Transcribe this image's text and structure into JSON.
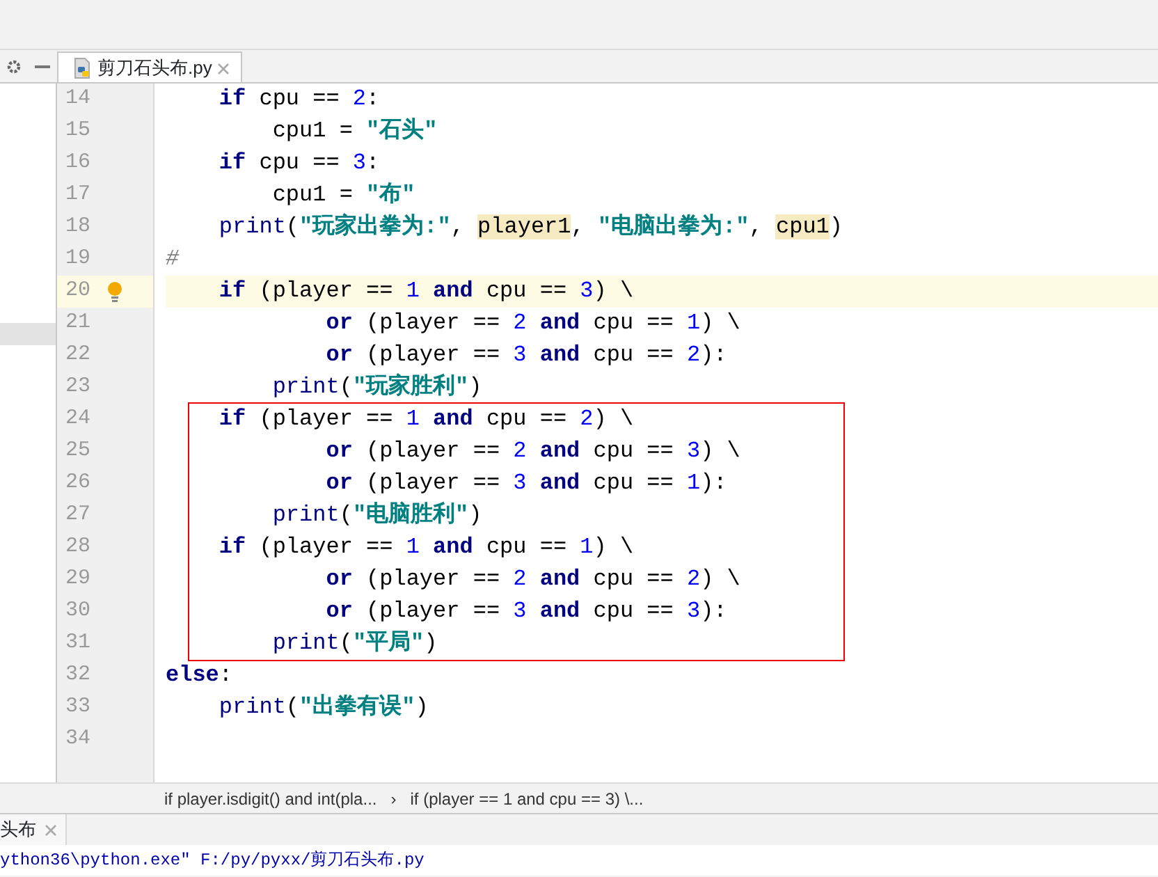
{
  "editor_tab": {
    "label": "剪刀石头布.py",
    "selected": true
  },
  "code_lines": [
    {
      "number": "14",
      "current": false,
      "tokens": [
        {
          "kind": "kw",
          "text": "    if"
        },
        {
          "kind": "plain",
          "text": " cpu == "
        },
        {
          "kind": "num",
          "text": "2"
        },
        {
          "kind": "plain",
          "text": ":"
        }
      ]
    },
    {
      "number": "15",
      "current": false,
      "tokens": [
        {
          "kind": "plain",
          "text": "        cpu1 = "
        },
        {
          "kind": "str",
          "text": "\"石头\""
        }
      ]
    },
    {
      "number": "16",
      "current": false,
      "tokens": [
        {
          "kind": "kw",
          "text": "    if"
        },
        {
          "kind": "plain",
          "text": " cpu == "
        },
        {
          "kind": "num",
          "text": "3"
        },
        {
          "kind": "plain",
          "text": ":"
        }
      ]
    },
    {
      "number": "17",
      "current": false,
      "tokens": [
        {
          "kind": "plain",
          "text": "        cpu1 = "
        },
        {
          "kind": "str",
          "text": "\"布\""
        }
      ]
    },
    {
      "number": "18",
      "current": false,
      "tokens": [
        {
          "kind": "builtin",
          "text": "    print"
        },
        {
          "kind": "plain",
          "text": "("
        },
        {
          "kind": "str",
          "text": "\"玩家出拳为:\""
        },
        {
          "kind": "plain",
          "text": ", "
        },
        {
          "kind": "ref",
          "text": "player1"
        },
        {
          "kind": "plain",
          "text": ", "
        },
        {
          "kind": "str",
          "text": "\"电脑出拳为:\""
        },
        {
          "kind": "plain",
          "text": ", "
        },
        {
          "kind": "ref",
          "text": "cpu1"
        },
        {
          "kind": "plain",
          "text": ")"
        }
      ]
    },
    {
      "number": "19",
      "current": false,
      "tokens": [
        {
          "kind": "comment",
          "text": "#"
        }
      ]
    },
    {
      "number": "20",
      "current": true,
      "tokens": [
        {
          "kind": "kw",
          "text": "    if"
        },
        {
          "kind": "plain",
          "text": " (player == "
        },
        {
          "kind": "num",
          "text": "1"
        },
        {
          "kind": "kw",
          "text": " and"
        },
        {
          "kind": "plain",
          "text": " cpu == "
        },
        {
          "kind": "num",
          "text": "3"
        },
        {
          "kind": "plain",
          "text": ") \\"
        }
      ]
    },
    {
      "number": "21",
      "current": false,
      "tokens": [
        {
          "kind": "kw",
          "text": "            or"
        },
        {
          "kind": "plain",
          "text": " (player == "
        },
        {
          "kind": "num",
          "text": "2"
        },
        {
          "kind": "kw",
          "text": " and"
        },
        {
          "kind": "plain",
          "text": " cpu == "
        },
        {
          "kind": "num",
          "text": "1"
        },
        {
          "kind": "plain",
          "text": ") \\"
        }
      ]
    },
    {
      "number": "22",
      "current": false,
      "tokens": [
        {
          "kind": "kw",
          "text": "            or"
        },
        {
          "kind": "plain",
          "text": " (player == "
        },
        {
          "kind": "num",
          "text": "3"
        },
        {
          "kind": "kw",
          "text": " and"
        },
        {
          "kind": "plain",
          "text": " cpu == "
        },
        {
          "kind": "num",
          "text": "2"
        },
        {
          "kind": "plain",
          "text": "):"
        }
      ]
    },
    {
      "number": "23",
      "current": false,
      "tokens": [
        {
          "kind": "builtin",
          "text": "        print"
        },
        {
          "kind": "plain",
          "text": "("
        },
        {
          "kind": "str",
          "text": "\"玩家胜利\""
        },
        {
          "kind": "plain",
          "text": ")"
        }
      ]
    },
    {
      "number": "24",
      "current": false,
      "tokens": [
        {
          "kind": "kw",
          "text": "    if"
        },
        {
          "kind": "plain",
          "text": " (player == "
        },
        {
          "kind": "num",
          "text": "1"
        },
        {
          "kind": "kw",
          "text": " and"
        },
        {
          "kind": "plain",
          "text": " cpu == "
        },
        {
          "kind": "num",
          "text": "2"
        },
        {
          "kind": "plain",
          "text": ") \\"
        }
      ]
    },
    {
      "number": "25",
      "current": false,
      "tokens": [
        {
          "kind": "kw",
          "text": "            or"
        },
        {
          "kind": "plain",
          "text": " (player == "
        },
        {
          "kind": "num",
          "text": "2"
        },
        {
          "kind": "kw",
          "text": " and"
        },
        {
          "kind": "plain",
          "text": " cpu == "
        },
        {
          "kind": "num",
          "text": "3"
        },
        {
          "kind": "plain",
          "text": ") \\"
        }
      ]
    },
    {
      "number": "26",
      "current": false,
      "tokens": [
        {
          "kind": "kw",
          "text": "            or"
        },
        {
          "kind": "plain",
          "text": " (player == "
        },
        {
          "kind": "num",
          "text": "3"
        },
        {
          "kind": "kw",
          "text": " and"
        },
        {
          "kind": "plain",
          "text": " cpu == "
        },
        {
          "kind": "num",
          "text": "1"
        },
        {
          "kind": "plain",
          "text": "):"
        }
      ]
    },
    {
      "number": "27",
      "current": false,
      "tokens": [
        {
          "kind": "builtin",
          "text": "        print"
        },
        {
          "kind": "plain",
          "text": "("
        },
        {
          "kind": "str",
          "text": "\"电脑胜利\""
        },
        {
          "kind": "plain",
          "text": ")"
        }
      ]
    },
    {
      "number": "28",
      "current": false,
      "tokens": [
        {
          "kind": "kw",
          "text": "    if"
        },
        {
          "kind": "plain",
          "text": " (player == "
        },
        {
          "kind": "num",
          "text": "1"
        },
        {
          "kind": "kw",
          "text": " and"
        },
        {
          "kind": "plain",
          "text": " cpu == "
        },
        {
          "kind": "num",
          "text": "1"
        },
        {
          "kind": "plain",
          "text": ") \\"
        }
      ]
    },
    {
      "number": "29",
      "current": false,
      "tokens": [
        {
          "kind": "kw",
          "text": "            or"
        },
        {
          "kind": "plain",
          "text": " (player == "
        },
        {
          "kind": "num",
          "text": "2"
        },
        {
          "kind": "kw",
          "text": " and"
        },
        {
          "kind": "plain",
          "text": " cpu == "
        },
        {
          "kind": "num",
          "text": "2"
        },
        {
          "kind": "plain",
          "text": ") \\"
        }
      ]
    },
    {
      "number": "30",
      "current": false,
      "tokens": [
        {
          "kind": "kw",
          "text": "            or"
        },
        {
          "kind": "plain",
          "text": " (player == "
        },
        {
          "kind": "num",
          "text": "3"
        },
        {
          "kind": "kw",
          "text": " and"
        },
        {
          "kind": "plain",
          "text": " cpu == "
        },
        {
          "kind": "num",
          "text": "3"
        },
        {
          "kind": "plain",
          "text": "):"
        }
      ]
    },
    {
      "number": "31",
      "current": false,
      "tokens": [
        {
          "kind": "builtin",
          "text": "        print"
        },
        {
          "kind": "plain",
          "text": "("
        },
        {
          "kind": "str",
          "text": "\"平局\""
        },
        {
          "kind": "plain",
          "text": ")"
        }
      ]
    },
    {
      "number": "32",
      "current": false,
      "tokens": [
        {
          "kind": "kw",
          "text": "else"
        },
        {
          "kind": "plain",
          "text": ":"
        }
      ]
    },
    {
      "number": "33",
      "current": false,
      "tokens": [
        {
          "kind": "builtin",
          "text": "    print"
        },
        {
          "kind": "plain",
          "text": "("
        },
        {
          "kind": "str",
          "text": "\"出拳有误\""
        },
        {
          "kind": "plain",
          "text": ")"
        }
      ]
    },
    {
      "number": "34",
      "current": false
    }
  ],
  "breadcrumbs": [
    "if player.isdigit() and int(pla...",
    "›",
    "if (player == 1 and cpu == 3) \\..."
  ],
  "run_tab": {
    "label": "头布"
  },
  "console_lines": [
    "ython36\\python.exe\" F:/py/pyxx/剪刀石头布.py"
  ]
}
